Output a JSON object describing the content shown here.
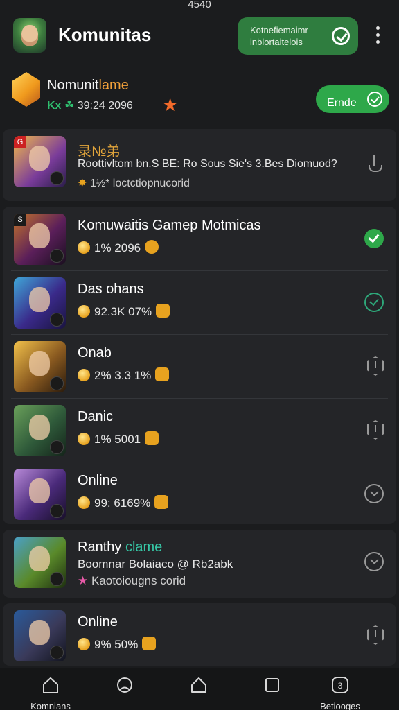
{
  "status_bar": {
    "time": "4540"
  },
  "header": {
    "title": "Komunitas",
    "notification": {
      "line1": "Kotnefiemaimr",
      "line2": "inblortaitelois"
    }
  },
  "profile": {
    "name_main": "Nomunit",
    "name_accent": "lame",
    "meta_prefix": "Kx",
    "meta_green": "☘",
    "meta_value": "39:24 2096",
    "button_label": "Ernde"
  },
  "items": [
    {
      "title": "录№弟",
      "title_style": "gold",
      "subtitle": "Roottivltom bn.S BE: Ro Sous Sie's 3.Bes Diomuod?",
      "detail": "1½* loctctiopnucorid",
      "status": "info"
    },
    {
      "title": "Komuwaitis Gamep Motmicas",
      "subtitle": "1%  2096",
      "status": "check-green"
    },
    {
      "title": "Das ohans",
      "subtitle": "92.3K 07%",
      "status": "check-outline"
    },
    {
      "title": "Onab",
      "subtitle": "2%  3.3 1%",
      "status": "shield"
    },
    {
      "title": "Danic",
      "subtitle": "1%  5001",
      "status": "shield"
    },
    {
      "title": "Online",
      "subtitle": "99: 6169%",
      "status": "chevron"
    },
    {
      "title_main": "Ranthy",
      "title_accent": "clame",
      "subtitle": "Boomnar Bolaiaco @ Rb2abk",
      "detail": "Kaotoiougns corid",
      "status": "chevron"
    },
    {
      "title": "Online",
      "subtitle": "9%  50%",
      "status": "shield"
    }
  ],
  "bottom_nav": [
    {
      "label": "Komnians",
      "icon": "home-icon"
    },
    {
      "label": "",
      "icon": "profile-icon"
    },
    {
      "label": "",
      "icon": "home-outline-icon"
    },
    {
      "label": "",
      "icon": "square-icon"
    },
    {
      "label": "Betiooges",
      "icon": "bell-icon"
    }
  ],
  "colors": {
    "background": "#1b1c1e",
    "card": "#242528",
    "accent_green": "#2ea84a",
    "gold": "#e2a53b"
  }
}
